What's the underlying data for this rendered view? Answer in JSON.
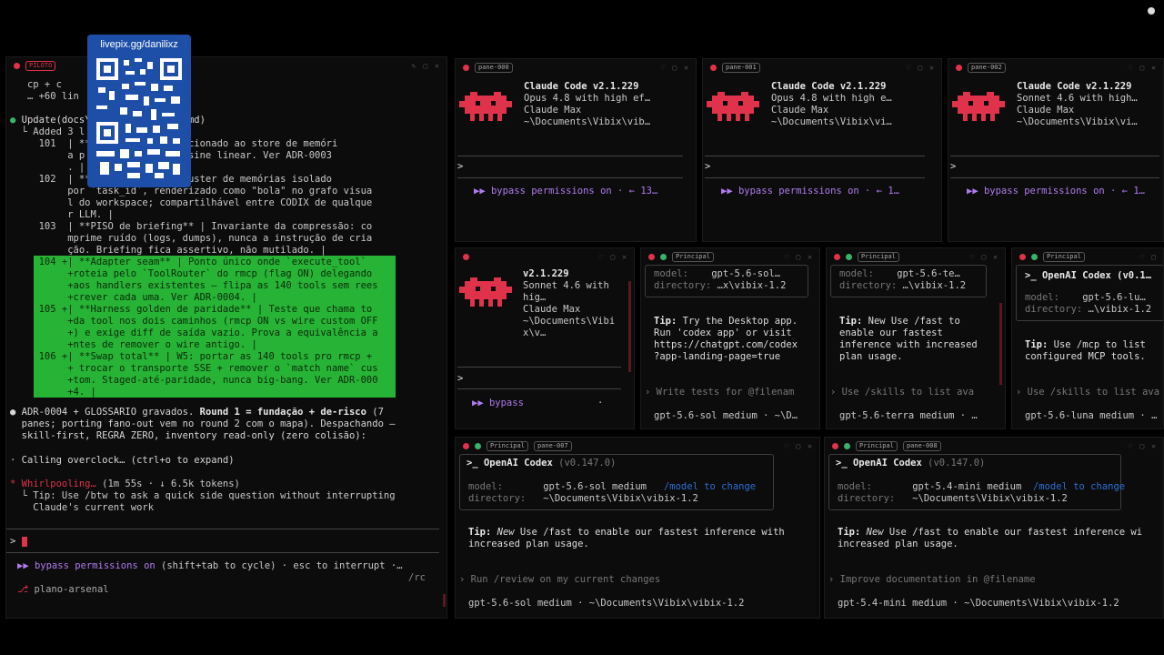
{
  "overlay": {
    "qr_url": "livepix.gg/danilixz"
  },
  "left_pane": {
    "tab_label": "PILOTO",
    "lines": {
      "l1": "   cp + c         oi depre",
      "l2": "   … +60 lin        and)",
      "update_head": "Update(docs\\          SSARIO.md)",
      "update_sub": "  └ Added 3 l",
      "r101a": "     101  | **          ANN adicionado ao store de memóri",
      "r101b": "          a p          busca cosine linear. Ver ADR-0003",
      "r101c": "          . |",
      "r102a": "     102  | **          ** | Cluster de memórias isolado",
      "r102b": "          por `task_id`, renderizado como \"bola\" no grafo visua",
      "r102c": "          l do workspace; compartilhável entre CODIX de qualque",
      "r102d": "          r LLM. |",
      "r103a": "     103  | **PISO de briefing** | Invariante da compressão: co",
      "r103b": "          mprime ruído (logs, dumps), nunca a instrução de cria",
      "r103c": "          ção. Briefing fica assertivo, não mutilado. |"
    },
    "green_lines": [
      "     104 +| **Adapter seam** | Ponto único onde `execute_tool`",
      "          +roteia pelo `ToolRouter` do rmcp (flag ON) delegando",
      "          +aos handlers existentes — flipa as 140 tools sem rees",
      "          +crever cada uma. Ver ADR-0004. |",
      "     105 +| **Harness golden de paridade** | Teste que chama to",
      "          +da tool nos dois caminhos (rmcp ON vs wire custom OFF",
      "          +) e exige diff de saída vazio. Prova a equivalência a",
      "          +ntes de remover o wire antigo. |",
      "     106 +| **Swap total** | W5: portar as 140 tools pro rmcp +",
      "          + trocar o transporte SSE + remover o `match name` cus",
      "          +tom. Staged-até-paridade, nunca big-bang. Ver ADR-000",
      "          +4. |"
    ],
    "summary": {
      "s1_pre": "● ADR-0004 + GLOSSARIO gravados. ",
      "s1_bold": "Round 1 = fundação + de-risco",
      "s1_post": " (7",
      "s2": "  panes; porting fano-out vem no round 2 com o mapa). Despachando —",
      "s3": "  skill-first, REGRA ZERO, inventory read-only (zero colisão):"
    },
    "calling": "· Calling overclock… (ctrl+o to expand)",
    "whirl_word": "* Whirlpooling…",
    "whirl_rest": " (1m 55s · ↓ 6.5k tokens)",
    "tip1": "  └ Tip: Use /btw to ask a quick side question without interrupting",
    "tip2": "    Claude's current work",
    "prompt": ">",
    "bypass": "▶▶ bypass permissions on",
    "bypass_rest": " (shift+tab to cycle) · esc to interrupt ·…",
    "rc": "/rc",
    "plano": "plano-arsenal"
  },
  "claude_panes": [
    {
      "tag": "pane-000",
      "ver": "Claude Code v2.1.229",
      "model": "Opus 4.8 with high ef…",
      "plan": "Claude Max",
      "path": "~\\Documents\\Vibix\\vib…",
      "bypass": "▶▶ bypass permissions on · ← 13…"
    },
    {
      "tag": "pane-001",
      "ver": "Claude Code v2.1.229",
      "model": "Opus 4.8 with high e…",
      "plan": "Claude Max",
      "path": "~\\Documents\\Vibix\\vi…",
      "bypass": "▶▶ bypass permissions on · ← 1…"
    },
    {
      "tag": "pane-002",
      "ver": "Claude Code v2.1.229",
      "model": "Sonnet 4.6 with high…",
      "plan": "Claude Max",
      "path": "~\\Documents\\Vibix\\vi…",
      "bypass": "▶▶ bypass permissions on · ← 1…"
    }
  ],
  "claude_small": {
    "ver": "v2.1.229",
    "model1": "Sonnet 4.6 with",
    "model2": "hig…",
    "plan": "Claude Max",
    "path1": "~\\Documents\\Vibi",
    "path2": "x\\v…",
    "bypass": "▶▶ bypass",
    "dot": "·"
  },
  "codex_mid": [
    {
      "tag": "Principal",
      "model_label": "model:",
      "model": "gpt-5.6-sol…",
      "dir_label": "directory:",
      "dir": "…x\\vibix-1.2",
      "tip_label": "Tip:",
      "tip": " Try the Desktop app.\nRun 'codex app' or visit\nhttps://chatgpt.com/codex\n?app-landing-page=true",
      "input": "› Write tests for @filenam",
      "status": "gpt-5.6-sol medium · ~\\D…"
    },
    {
      "tag": "Principal",
      "model_label": "model:",
      "model": "gpt-5.6-te…",
      "dir_label": "directory:",
      "dir": "…\\vibix-1.2",
      "tip_label": "Tip:",
      "tip": " New Use /fast to\nenable our fastest\ninference with increased\nplan usage.",
      "input": "› Use /skills to list ava",
      "status": "gpt-5.6-terra medium · …"
    },
    {
      "tag": "Principal",
      "title": ">_ OpenAI Codex (v0.1…",
      "model_label": "model:",
      "model": "gpt-5.6-lu…",
      "dir_label": "directory:",
      "dir": "…\\vibix-1.2",
      "tip_label": "Tip:",
      "tip": " Use /mcp to list\nconfigured MCP tools.",
      "input": "› Use /skills to list ava",
      "status": "gpt-5.6-luna medium · …"
    }
  ],
  "codex_bottom": [
    {
      "tag": "Principal",
      "tag2": "pane-007",
      "title": ">_ OpenAI Codex",
      "ver": "(v0.147.0)",
      "model_label": "model:",
      "model": "gpt-5.6-sol medium",
      "model_hint": "/model to change",
      "dir_label": "directory:",
      "dir": "~\\Documents\\Vibix\\vibix-1.2",
      "tip_label": "Tip:",
      "tip_new": " New",
      "tip": " Use /fast to enable our fastest inference with\nincreased plan usage.",
      "input": "› Run /review on my current changes",
      "status": "gpt-5.6-sol medium · ~\\Documents\\Vibix\\vibix-1.2"
    },
    {
      "tag": "Principal",
      "tag2": "pane-008",
      "title": ">_ OpenAI Codex",
      "ver": "(v0.147.0)",
      "model_label": "model:",
      "model": "gpt-5.4-mini medium",
      "model_hint": "/model to change",
      "dir_label": "directory:",
      "dir": "~\\Documents\\Vibix\\vibix-1.2",
      "tip_label": "Tip:",
      "tip_new": " New",
      "tip": " Use /fast to enable our fastest inference wi\nincreased plan usage.",
      "input": "› Improve documentation in @filename",
      "status": "gpt-5.4-mini medium · ~\\Documents\\Vibix\\vibix-1.2"
    }
  ],
  "colors": {
    "accent": "#e0324a",
    "green": "#27b336",
    "purple": "#b07cf0",
    "codex_accent": "#2e6fd6"
  }
}
